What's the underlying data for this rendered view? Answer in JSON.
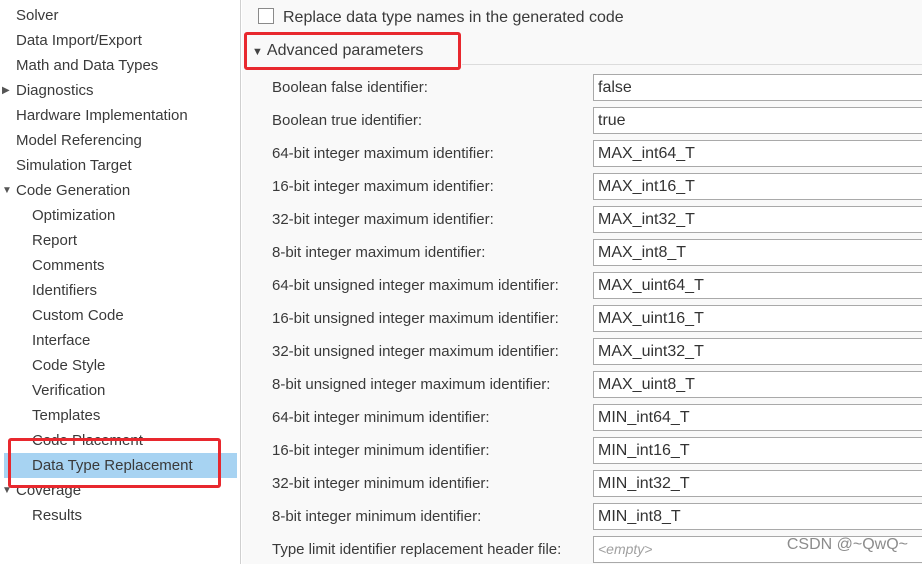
{
  "tree": {
    "items": [
      {
        "label": "Solver",
        "level": 0,
        "caret": ""
      },
      {
        "label": "Data Import/Export",
        "level": 0,
        "caret": ""
      },
      {
        "label": "Math and Data Types",
        "level": 0,
        "caret": ""
      },
      {
        "label": "Diagnostics",
        "level": 0,
        "caret": "▶"
      },
      {
        "label": "Hardware Implementation",
        "level": 0,
        "caret": ""
      },
      {
        "label": "Model Referencing",
        "level": 0,
        "caret": ""
      },
      {
        "label": "Simulation Target",
        "level": 0,
        "caret": ""
      },
      {
        "label": "Code Generation",
        "level": 0,
        "caret": "▼"
      },
      {
        "label": "Optimization",
        "level": 1,
        "caret": ""
      },
      {
        "label": "Report",
        "level": 1,
        "caret": ""
      },
      {
        "label": "Comments",
        "level": 1,
        "caret": ""
      },
      {
        "label": "Identifiers",
        "level": 1,
        "caret": ""
      },
      {
        "label": "Custom Code",
        "level": 1,
        "caret": ""
      },
      {
        "label": "Interface",
        "level": 1,
        "caret": ""
      },
      {
        "label": "Code Style",
        "level": 1,
        "caret": ""
      },
      {
        "label": "Verification",
        "level": 1,
        "caret": ""
      },
      {
        "label": "Templates",
        "level": 1,
        "caret": ""
      },
      {
        "label": "Code Placement",
        "level": 1,
        "caret": ""
      },
      {
        "label": "Data Type Replacement",
        "level": 1,
        "caret": "",
        "selected": true
      },
      {
        "label": "Coverage",
        "level": 0,
        "caret": "▼"
      },
      {
        "label": "Results",
        "level": 1,
        "caret": ""
      }
    ]
  },
  "panel": {
    "replace_checkbox_label": "Replace data type names in the generated code",
    "replace_checked": false,
    "advanced_arrow": "▼",
    "advanced_label": "Advanced parameters",
    "params": [
      {
        "label": "Boolean false identifier:",
        "value": "false"
      },
      {
        "label": "Boolean true identifier:",
        "value": "true"
      },
      {
        "label": "64-bit integer maximum identifier:",
        "value": "MAX_int64_T"
      },
      {
        "label": "16-bit integer maximum identifier:",
        "value": "MAX_int16_T"
      },
      {
        "label": "32-bit integer maximum identifier:",
        "value": "MAX_int32_T"
      },
      {
        "label": "8-bit integer maximum identifier:",
        "value": "MAX_int8_T"
      },
      {
        "label": "64-bit unsigned integer maximum identifier:",
        "value": "MAX_uint64_T"
      },
      {
        "label": "16-bit unsigned integer maximum identifier:",
        "value": "MAX_uint16_T"
      },
      {
        "label": "32-bit unsigned integer maximum identifier:",
        "value": "MAX_uint32_T"
      },
      {
        "label": "8-bit unsigned integer maximum identifier:",
        "value": "MAX_uint8_T"
      },
      {
        "label": "64-bit integer minimum identifier:",
        "value": "MIN_int64_T"
      },
      {
        "label": "16-bit integer minimum identifier:",
        "value": "MIN_int16_T"
      },
      {
        "label": "32-bit integer minimum identifier:",
        "value": "MIN_int32_T"
      },
      {
        "label": "8-bit integer minimum identifier:",
        "value": "MIN_int8_T"
      },
      {
        "label": "Type limit identifier replacement header file:",
        "value": "",
        "placeholder": "<empty>"
      }
    ]
  },
  "watermark": "CSDN @~QwQ~",
  "colors": {
    "selection": "#a7d3f2",
    "annotation": "#e8282e",
    "panel_bg": "#f9f9f9"
  }
}
